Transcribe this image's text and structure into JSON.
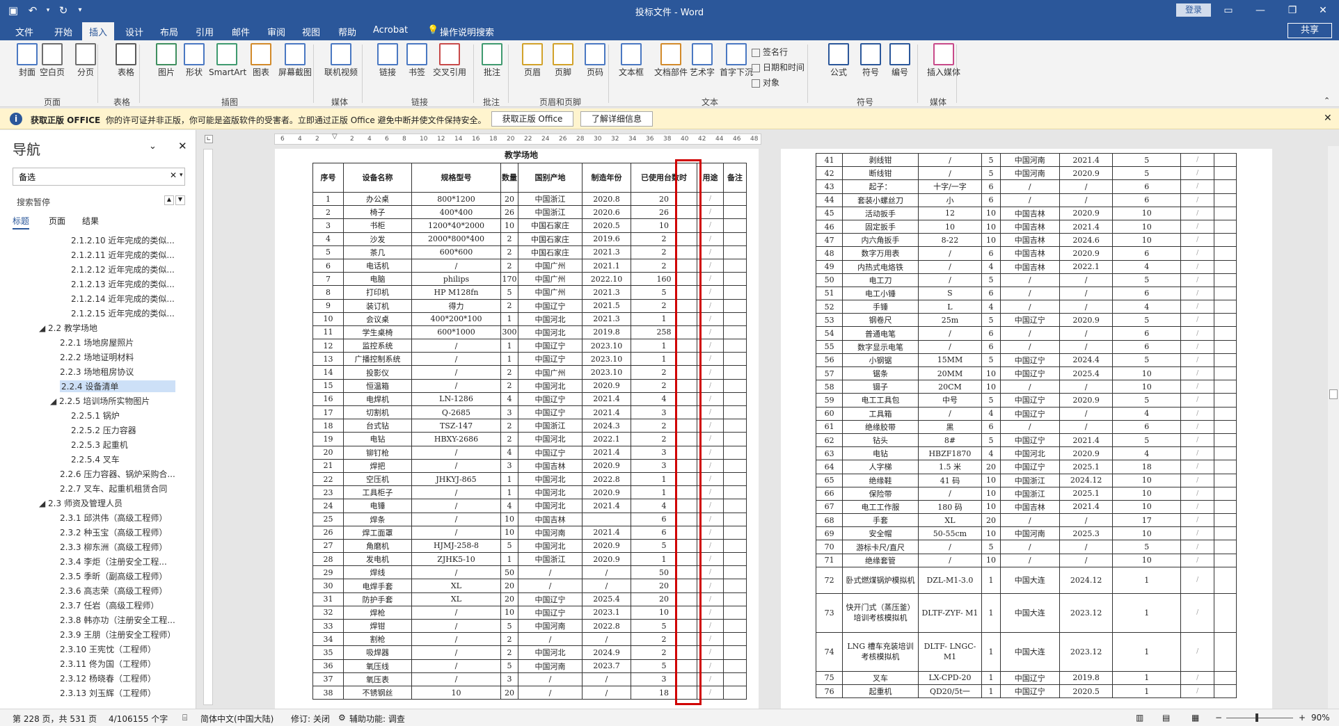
{
  "title_bar": {
    "title": "投标文件 - Word",
    "login": "登录"
  },
  "tabs": [
    "文件",
    "开始",
    "插入",
    "设计",
    "布局",
    "引用",
    "邮件",
    "审阅",
    "视图",
    "帮助",
    "Acrobat",
    "操作说明搜索"
  ],
  "active_tab": "插入",
  "share": "共享",
  "ribbon": {
    "buttons": [
      [
        "封面",
        "页面"
      ],
      [
        "空白页",
        "页面"
      ],
      [
        "分页",
        "页面"
      ],
      [
        "表格",
        "表格"
      ],
      [
        "图片",
        "插图"
      ],
      [
        "形状",
        "插图"
      ],
      [
        "SmartArt",
        "插图"
      ],
      [
        "图表",
        "插图"
      ],
      [
        "屏幕截图",
        "插图"
      ],
      [
        "联机视频",
        "媒体"
      ],
      [
        "链接",
        "链接"
      ],
      [
        "书签",
        "链接"
      ],
      [
        "交叉引用",
        "链接"
      ],
      [
        "批注",
        "批注"
      ],
      [
        "页眉",
        "页眉和页脚"
      ],
      [
        "页脚",
        "页眉和页脚"
      ],
      [
        "页码",
        "页眉和页脚"
      ],
      [
        "文本框",
        "文本"
      ],
      [
        "文档部件",
        "文本"
      ],
      [
        "艺术字",
        "文本"
      ],
      [
        "首字下沉",
        "文本"
      ],
      [
        "公式",
        "符号"
      ],
      [
        "符号",
        "符号"
      ],
      [
        "编号",
        "符号"
      ],
      [
        "插入媒体",
        "媒体"
      ]
    ],
    "small": [
      "签名行",
      "日期和时间",
      "对象"
    ],
    "groups": [
      "页面",
      "表格",
      "插图",
      "媒体",
      "链接",
      "批注",
      "页眉和页脚",
      "文本",
      "符号",
      "媒体"
    ]
  },
  "msgbar": {
    "title": "获取正版 OFFICE",
    "text": "你的许可证并非正版，你可能是盗版软件的受害者。立即通过正版 Office 避免中断并使文件保持安全。",
    "btn1": "获取正版 Office",
    "btn2": "了解详细信息"
  },
  "nav": {
    "title": "导航",
    "search": "备选",
    "status": "搜索暂停",
    "tabs": [
      "标题",
      "页面",
      "结果"
    ],
    "items": [
      [
        "2.1.2.10 近年完成的类似...",
        5
      ],
      [
        "2.1.2.11 近年完成的类似...",
        5
      ],
      [
        "2.1.2.12 近年完成的类似...",
        5
      ],
      [
        "2.1.2.13 近年完成的类似...",
        5
      ],
      [
        "2.1.2.14 近年完成的类似...",
        5
      ],
      [
        "2.1.2.15 近年完成的类似...",
        5
      ],
      [
        "◢ 2.2 教学场地",
        1
      ],
      [
        "2.2.1 场地房屋照片",
        4
      ],
      [
        "2.2.2 场地证明材料",
        4
      ],
      [
        "2.2.3 场地租房协议",
        4
      ],
      [
        "2.2.4 设备清单",
        4
      ],
      [
        "◢ 2.2.5 培训场所实物图片",
        3
      ],
      [
        "2.2.5.1 锅炉",
        5
      ],
      [
        "2.2.5.2 压力容器",
        5
      ],
      [
        "2.2.5.3 起重机",
        5
      ],
      [
        "2.2.5.4 叉车",
        5
      ],
      [
        "2.2.6 压力容器、锅炉采购合...",
        4
      ],
      [
        "2.2.7 叉车、起重机租赁合同",
        4
      ],
      [
        "◢ 2.3 师资及管理人员",
        1
      ],
      [
        "2.3.1 邱洪伟（高级工程师）",
        4
      ],
      [
        "2.3.2 种玉宝（高级工程师）",
        4
      ],
      [
        "2.3.3 柳东洲（高级工程师）",
        4
      ],
      [
        "2.3.4 李炬（注册安全工程...",
        4
      ],
      [
        "2.3.5 季昕（副高级工程师）",
        4
      ],
      [
        "2.3.6 高志荣（高级工程师）",
        4
      ],
      [
        "2.3.7 任岩（高级工程师）",
        4
      ],
      [
        "2.3.8 韩亦功（注册安全工程...",
        4
      ],
      [
        "2.3.9 王朋（注册安全工程师）",
        4
      ],
      [
        "2.3.10 王宪忱（工程师）",
        4
      ],
      [
        "2.3.11 佟为国（工程师）",
        4
      ],
      [
        "2.3.12 杨晓春（工程师）",
        4
      ],
      [
        "2.3.13 刘玉辉（工程师）",
        4
      ]
    ],
    "selected_index": 10
  },
  "ruler": [
    "6",
    "4",
    "2",
    "",
    "2",
    "4",
    "6",
    "8",
    "10",
    "12",
    "14",
    "16",
    "18",
    "20",
    "22",
    "24",
    "26",
    "28",
    "30",
    "32",
    "34",
    "36",
    "38",
    "40",
    "42",
    "44",
    "46",
    "48"
  ],
  "left_page": {
    "caption": "教学场地",
    "headers": [
      "序号",
      "设备名称",
      "规格型号",
      "数量",
      "国别产地",
      "制造年份",
      "已使用台数时",
      "用途",
      "备注"
    ],
    "rows": [
      [
        "1",
        "办公桌",
        "800*1200",
        "20",
        "中国浙江",
        "2020.8",
        "20"
      ],
      [
        "2",
        "椅子",
        "400*400",
        "26",
        "中国浙江",
        "2020.6",
        "26"
      ],
      [
        "3",
        "书柜",
        "1200*40*2000",
        "10",
        "中国石家庄",
        "2020.5",
        "10"
      ],
      [
        "4",
        "沙发",
        "2000*800*400",
        "2",
        "中国石家庄",
        "2019.6",
        "2"
      ],
      [
        "5",
        "茶几",
        "600*600",
        "2",
        "中国石家庄",
        "2021.3",
        "2"
      ],
      [
        "6",
        "电话机",
        "/",
        "2",
        "中国广州",
        "2021.1",
        "2"
      ],
      [
        "7",
        "电脑",
        "philips",
        "170",
        "中国广州",
        "2022.10",
        "160"
      ],
      [
        "8",
        "打印机",
        "HP M128fn",
        "5",
        "中国广州",
        "2021.3",
        "5"
      ],
      [
        "9",
        "装订机",
        "得力",
        "2",
        "中国辽宁",
        "2021.5",
        "2"
      ],
      [
        "10",
        "会议桌",
        "400*200*100",
        "1",
        "中国河北",
        "2021.3",
        "1"
      ],
      [
        "11",
        "学生桌椅",
        "600*1000",
        "300",
        "中国河北",
        "2019.8",
        "258"
      ],
      [
        "12",
        "监控系统",
        "/",
        "1",
        "中国辽宁",
        "2023.10",
        "1"
      ],
      [
        "13",
        "广播控制系统",
        "/",
        "1",
        "中国辽宁",
        "2023.10",
        "1"
      ],
      [
        "14",
        "投影仪",
        "/",
        "2",
        "中国广州",
        "2023.10",
        "2"
      ],
      [
        "15",
        "恒温箱",
        "/",
        "2",
        "中国河北",
        "2020.9",
        "2"
      ],
      [
        "16",
        "电焊机",
        "LN-1286",
        "4",
        "中国辽宁",
        "2021.4",
        "4"
      ],
      [
        "17",
        "切割机",
        "Q-2685",
        "3",
        "中国辽宁",
        "2021.4",
        "3"
      ],
      [
        "18",
        "台式钻",
        "TSZ-147",
        "2",
        "中国浙江",
        "2024.3",
        "2"
      ],
      [
        "19",
        "电钻",
        "HBXY-2686",
        "2",
        "中国河北",
        "2022.1",
        "2"
      ],
      [
        "20",
        "铆钉枪",
        "/",
        "4",
        "中国辽宁",
        "2021.4",
        "3"
      ],
      [
        "21",
        "焊把",
        "/",
        "3",
        "中国吉林",
        "2020.9",
        "3"
      ],
      [
        "22",
        "空压机",
        "JHKYJ-865",
        "1",
        "中国河北",
        "2022.8",
        "1"
      ],
      [
        "23",
        "工具柜子",
        "/",
        "1",
        "中国河北",
        "2020.9",
        "1"
      ],
      [
        "24",
        "电锤",
        "/",
        "4",
        "中国河北",
        "2021.4",
        "4"
      ],
      [
        "25",
        "焊条",
        "/",
        "10",
        "中国吉林",
        "",
        "6"
      ],
      [
        "26",
        "焊工面罩",
        "/",
        "10",
        "中国河南",
        "2021.4",
        "6"
      ],
      [
        "27",
        "角磨机",
        "HJMJ-258-8",
        "5",
        "中国河北",
        "2020.9",
        "5"
      ],
      [
        "28",
        "发电机",
        "ZJHK5-10",
        "1",
        "中国浙江",
        "2020.9",
        "1"
      ],
      [
        "29",
        "焊线",
        "/",
        "50",
        "/",
        "/",
        "50"
      ],
      [
        "30",
        "电焊手套",
        "XL",
        "20",
        "/",
        "/",
        "20"
      ],
      [
        "31",
        "防护手套",
        "XL",
        "20",
        "中国辽宁",
        "2025.4",
        "20"
      ],
      [
        "32",
        "焊枪",
        "/",
        "10",
        "中国辽宁",
        "2023.1",
        "10"
      ],
      [
        "33",
        "焊钳",
        "/",
        "5",
        "中国河南",
        "2022.8",
        "5"
      ],
      [
        "34",
        "割枪",
        "/",
        "2",
        "/",
        "/",
        "2"
      ],
      [
        "35",
        "吸焊器",
        "/",
        "2",
        "中国河北",
        "2024.9",
        "2"
      ],
      [
        "36",
        "氧压线",
        "/",
        "5",
        "中国河南",
        "2023.7",
        "5"
      ],
      [
        "37",
        "氧压表",
        "/",
        "3",
        "/",
        "/",
        "3"
      ],
      [
        "38",
        "不锈钢丝",
        "10",
        "20",
        "/",
        "/",
        "18"
      ]
    ]
  },
  "right_page": {
    "rows": [
      [
        "41",
        "剥线钳",
        "/",
        "5",
        "中国河南",
        "2021.4",
        "5"
      ],
      [
        "42",
        "断线钳",
        "/",
        "5",
        "中国河南",
        "2020.9",
        "5"
      ],
      [
        "43",
        "起子：",
        "十字/一字",
        "6",
        "/",
        "/",
        "6"
      ],
      [
        "44",
        "套装小螺丝刀",
        "小",
        "6",
        "/",
        "/",
        "6"
      ],
      [
        "45",
        "活动扳手",
        "12",
        "10",
        "中国吉林",
        "2020.9",
        "10"
      ],
      [
        "46",
        "固定扳手",
        "10",
        "10",
        "中国吉林",
        "2021.4",
        "10"
      ],
      [
        "47",
        "内六角扳手",
        "8-22",
        "10",
        "中国吉林",
        "2024.6",
        "10"
      ],
      [
        "48",
        "数字万用表",
        "/",
        "6",
        "中国吉林",
        "2020.9",
        "6"
      ],
      [
        "49",
        "内热式电烙铁",
        "/",
        "4",
        "中国吉林",
        "2022.1",
        "4"
      ],
      [
        "50",
        "电工刀",
        "/",
        "5",
        "/",
        "/",
        "5"
      ],
      [
        "51",
        "电工小锤",
        "S",
        "6",
        "/",
        "/",
        "6"
      ],
      [
        "52",
        "手锤",
        "L",
        "4",
        "/",
        "/",
        "4"
      ],
      [
        "53",
        "钢卷尺",
        "25m",
        "5",
        "中国辽宁",
        "2020.9",
        "5"
      ],
      [
        "54",
        "普通电笔",
        "/",
        "6",
        "/",
        "/",
        "6"
      ],
      [
        "55",
        "数字显示电笔",
        "/",
        "6",
        "/",
        "/",
        "6"
      ],
      [
        "56",
        "小钢锯",
        "15MM",
        "5",
        "中国辽宁",
        "2024.4",
        "5"
      ],
      [
        "57",
        "锯条",
        "20MM",
        "10",
        "中国辽宁",
        "2025.4",
        "10"
      ],
      [
        "58",
        "镊子",
        "20CM",
        "10",
        "/",
        "/",
        "10"
      ],
      [
        "59",
        "电工工具包",
        "中号",
        "5",
        "中国辽宁",
        "2020.9",
        "5"
      ],
      [
        "60",
        "工具箱",
        "/",
        "4",
        "中国辽宁",
        "/",
        "4"
      ],
      [
        "61",
        "绝缘胶带",
        "黑",
        "6",
        "/",
        "/",
        "6"
      ],
      [
        "62",
        "钻头",
        "8#",
        "5",
        "中国辽宁",
        "2021.4",
        "5"
      ],
      [
        "63",
        "电钻",
        "HBZF1870",
        "4",
        "中国河北",
        "2020.9",
        "4"
      ],
      [
        "64",
        "人字梯",
        "1.5 米",
        "20",
        "中国辽宁",
        "2025.1",
        "18"
      ],
      [
        "65",
        "绝缘鞋",
        "41 码",
        "10",
        "中国浙江",
        "2024.12",
        "10"
      ],
      [
        "66",
        "保险带",
        "/",
        "10",
        "中国浙江",
        "2025.1",
        "10"
      ],
      [
        "67",
        "电工工作服",
        "180 码",
        "10",
        "中国吉林",
        "2021.4",
        "10"
      ],
      [
        "68",
        "手套",
        "XL",
        "20",
        "/",
        "/",
        "17"
      ],
      [
        "69",
        "安全帽",
        "50-55cm",
        "10",
        "中国河南",
        "2025.3",
        "10"
      ],
      [
        "70",
        "游标卡尺/直尺",
        "/",
        "5",
        "/",
        "/",
        "5"
      ],
      [
        "71",
        "绝缘套管",
        "/",
        "10",
        "/",
        "/",
        "10"
      ],
      [
        "72",
        "卧式燃煤锅炉模拟机",
        "DZL-M1-3.0",
        "1",
        "中国大连",
        "2024.12",
        "1"
      ],
      [
        "73",
        "快开门式（蒸压釜）培训考核模拟机",
        "DLTF-ZYF- M1",
        "1",
        "中国大连",
        "2023.12",
        "1"
      ],
      [
        "74",
        "LNG 槽车充装培训考核模拟机",
        "DLTF- LNGC-M1",
        "1",
        "中国大连",
        "2023.12",
        "1"
      ],
      [
        "75",
        "叉车",
        "LX-CPD-20",
        "1",
        "中国辽宁",
        "2019.8",
        "1"
      ],
      [
        "76",
        "起重机",
        "QD20/5t一",
        "1",
        "中国辽宁",
        "2020.5",
        "1"
      ]
    ]
  },
  "status": {
    "page": "第 228 页，共 531 页",
    "words": "4/106155 个字",
    "lang": "简体中文(中国大陆)",
    "track": "修订: 关闭",
    "access": "辅助功能: 调查",
    "zoom": "90%"
  },
  "colors": {
    "brand": "#2b579a",
    "highlight": "#d00000",
    "msgbar": "#fff4ce"
  }
}
